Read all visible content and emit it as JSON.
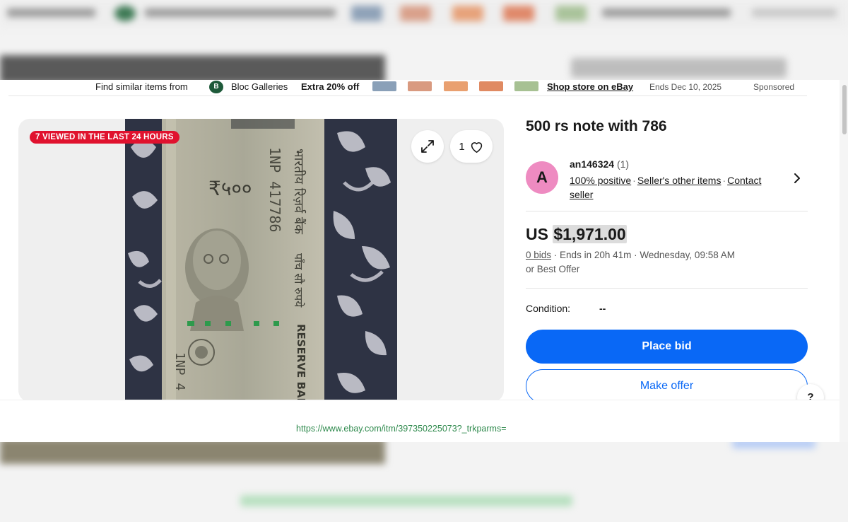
{
  "sponsored_strip": {
    "find_text": "Find similar items from",
    "store_name": "Bloc Galleries",
    "promo": "Extra 20% off",
    "shop_link": "Shop store on eBay",
    "ends": "Ends Dec 10, 2025",
    "sponsored": "Sponsored"
  },
  "gallery": {
    "viewed_badge": "7 VIEWED IN THE LAST 24 HOURS",
    "watch_count": "1"
  },
  "listing": {
    "title": "500 rs note with 786",
    "seller": {
      "avatar_letter": "A",
      "name": "an146324",
      "count": "(1)",
      "positive": "100% positive",
      "other_items": "Seller's other items",
      "contact": "Contact seller"
    },
    "price_prefix": "US",
    "price": "$1,971.00",
    "bids": "0 bids",
    "ends": "Ends in 20h 41m",
    "end_day": "Wednesday, 09:58 AM",
    "best_offer": "or Best Offer",
    "condition_label": "Condition:",
    "condition_value": "--",
    "place_bid": "Place bid",
    "make_offer": "Make offer",
    "help": "?"
  },
  "url": "https://www.ebay.com/itm/397350225073?_trkparms=",
  "note": {
    "denomination": "₹५००",
    "serial": "1NP 417786",
    "bank_hindi": "भारतीय रिज़र्व बैंक",
    "bank_english": "RESERVE BANK",
    "value_hindi": "पाँच सौ रुपये"
  },
  "colors": {
    "accent": "#0968f6",
    "badge": "#e0122e",
    "avatar": "#ee8bc1"
  }
}
